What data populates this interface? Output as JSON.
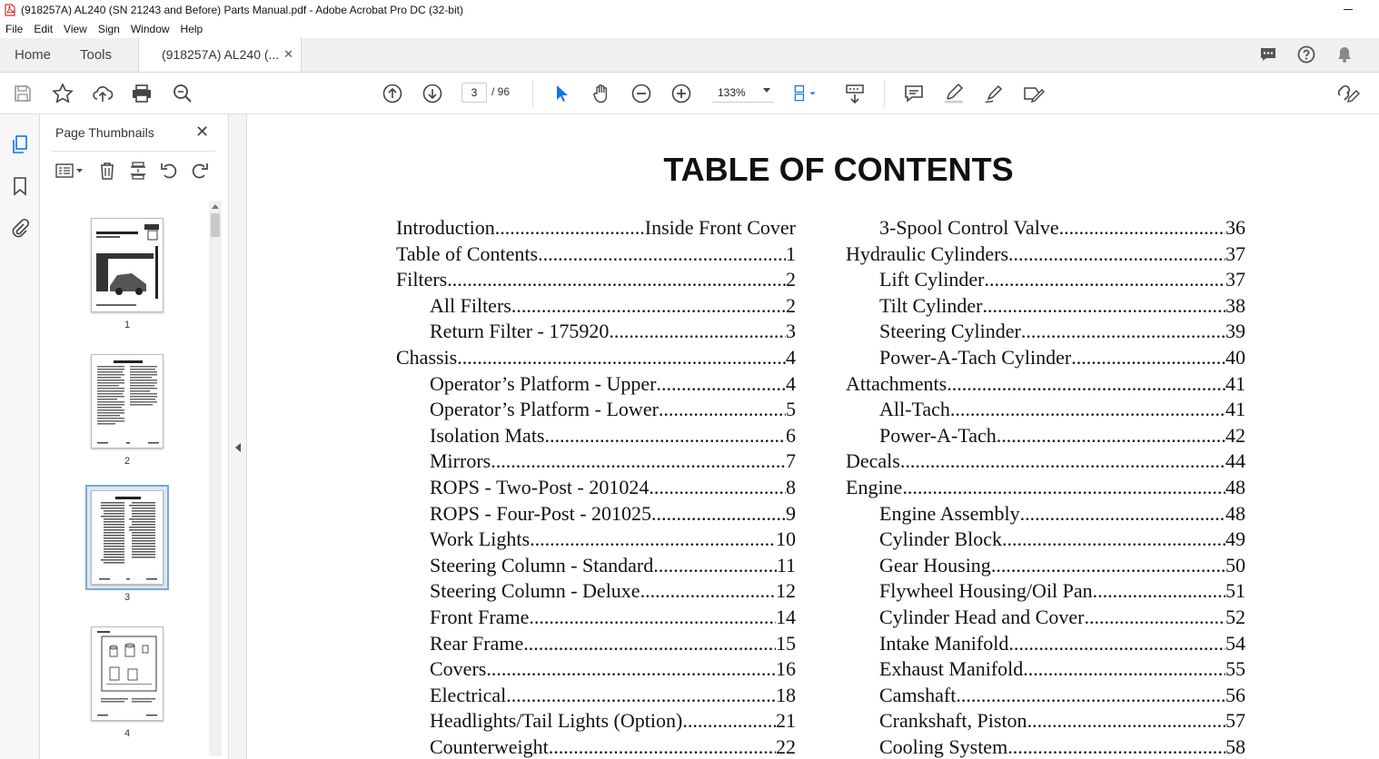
{
  "window": {
    "title": "(918257A) AL240 (SN 21243 and Before) Parts Manual.pdf - Adobe Acrobat Pro DC (32-bit)"
  },
  "menu": [
    "File",
    "Edit",
    "View",
    "Sign",
    "Window",
    "Help"
  ],
  "tabs": {
    "home": "Home",
    "tools": "Tools",
    "document": "(918257A) AL240 (..."
  },
  "toolbar": {
    "page_current": "3",
    "page_total": "/ 96",
    "zoom": "133%"
  },
  "thumbnails": {
    "title": "Page Thumbnails",
    "pages": [
      "1",
      "2",
      "3",
      "4"
    ],
    "selected": "3"
  },
  "document": {
    "title": "TABLE OF CONTENTS",
    "left_column": [
      {
        "text": "Introduction",
        "page": "Inside Front Cover",
        "sub": false
      },
      {
        "text": "Table of Contents",
        "page": "1",
        "sub": false
      },
      {
        "text": "Filters",
        "page": "2",
        "sub": false
      },
      {
        "text": "All Filters",
        "page": "2",
        "sub": true
      },
      {
        "text": "Return Filter - 175920",
        "page": "3",
        "sub": true
      },
      {
        "text": "Chassis",
        "page": "4",
        "sub": false
      },
      {
        "text": "Operator’s Platform - Upper",
        "page": "4",
        "sub": true
      },
      {
        "text": "Operator’s Platform - Lower",
        "page": "5",
        "sub": true
      },
      {
        "text": "Isolation Mats",
        "page": "6",
        "sub": true
      },
      {
        "text": "Mirrors",
        "page": "7",
        "sub": true
      },
      {
        "text": "ROPS - Two-Post - 201024",
        "page": "8",
        "sub": true
      },
      {
        "text": "ROPS - Four-Post - 201025",
        "page": "9",
        "sub": true
      },
      {
        "text": "Work Lights",
        "page": "10",
        "sub": true
      },
      {
        "text": "Steering Column - Standard",
        "page": "11",
        "sub": true
      },
      {
        "text": "Steering Column - Deluxe",
        "page": "12",
        "sub": true
      },
      {
        "text": "Front Frame",
        "page": "14",
        "sub": true
      },
      {
        "text": "Rear Frame",
        "page": "15",
        "sub": true
      },
      {
        "text": "Covers",
        "page": "16",
        "sub": true
      },
      {
        "text": "Electrical",
        "page": "18",
        "sub": true
      },
      {
        "text": "Headlights/Tail Lights (Option)",
        "page": "21",
        "sub": true
      },
      {
        "text": "Counterweight",
        "page": "22",
        "sub": true
      }
    ],
    "right_column": [
      {
        "text": "3-Spool Control Valve",
        "page": "36",
        "sub": true
      },
      {
        "text": "Hydraulic Cylinders",
        "page": "37",
        "sub": false
      },
      {
        "text": "Lift Cylinder",
        "page": "37",
        "sub": true
      },
      {
        "text": "Tilt Cylinder",
        "page": "38",
        "sub": true
      },
      {
        "text": "Steering Cylinder",
        "page": "39",
        "sub": true
      },
      {
        "text": "Power-A-Tach Cylinder",
        "page": "40",
        "sub": true
      },
      {
        "text": "Attachments",
        "page": "41",
        "sub": false
      },
      {
        "text": "All-Tach",
        "page": "41",
        "sub": true
      },
      {
        "text": "Power-A-Tach",
        "page": "42",
        "sub": true
      },
      {
        "text": "Decals",
        "page": "44",
        "sub": false
      },
      {
        "text": "Engine",
        "page": "48",
        "sub": false
      },
      {
        "text": "Engine Assembly",
        "page": "48",
        "sub": true
      },
      {
        "text": "Cylinder Block",
        "page": "49",
        "sub": true
      },
      {
        "text": "Gear Housing",
        "page": "50",
        "sub": true
      },
      {
        "text": "Flywheel Housing/Oil Pan",
        "page": "51",
        "sub": true
      },
      {
        "text": "Cylinder Head and Cover",
        "page": "52",
        "sub": true
      },
      {
        "text": "Intake Manifold",
        "page": "54",
        "sub": true
      },
      {
        "text": "Exhaust Manifold",
        "page": "55",
        "sub": true
      },
      {
        "text": "Camshaft",
        "page": "56",
        "sub": true
      },
      {
        "text": "Crankshaft, Piston",
        "page": "57",
        "sub": true
      },
      {
        "text": "Cooling System",
        "page": "58",
        "sub": true
      }
    ]
  }
}
